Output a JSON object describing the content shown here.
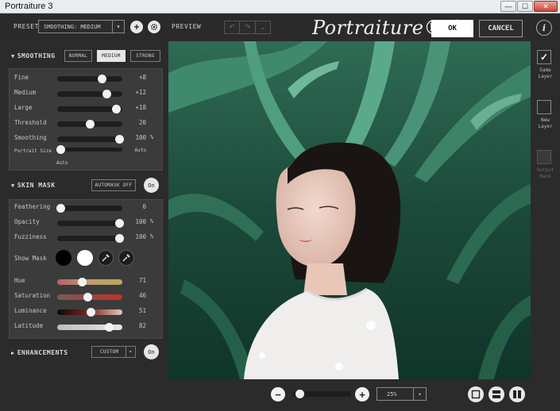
{
  "window": {
    "title": "Portraiture 3",
    "min_glyph": "—",
    "max_glyph": "☐",
    "close_glyph": "✕"
  },
  "toolbar": {
    "preset_label": "PRESET",
    "preset_value": "SMOOTHING: MEDIUM",
    "add_glyph": "+",
    "preview_label": "PREVIEW",
    "logo_text": "Portraiture® 3",
    "ok_label": "OK",
    "cancel_label": "CANCEL",
    "info_label": "i"
  },
  "smoothing": {
    "header": "SMOOTHING",
    "modes": [
      "NORMAL",
      "MEDIUM",
      "STRONG"
    ],
    "active_mode": "MEDIUM",
    "sliders": [
      {
        "label": "Fine",
        "value": "+8",
        "level": 0.68
      },
      {
        "label": "Medium",
        "value": "+12",
        "level": 0.76
      },
      {
        "label": "Large",
        "value": "+18",
        "level": 0.9
      },
      {
        "label": "Threshold",
        "value": "20",
        "level": 0.5
      },
      {
        "label": "Smoothing",
        "value": "100",
        "unit": "%",
        "level": 0.95
      }
    ],
    "portrait_size": {
      "label": "Portrait Size",
      "value": "Auto",
      "sub": "Auto",
      "level": 0.05
    }
  },
  "skin_mask": {
    "header": "SKIN MASK",
    "automask_label": "AUTOMASK OFF",
    "on_label": "On",
    "sliders": [
      {
        "label": "Feathering",
        "value": "0",
        "level": 0.05
      },
      {
        "label": "Opacity",
        "value": "100",
        "unit": "%",
        "level": 0.95
      },
      {
        "label": "Fuzziness",
        "value": "100",
        "unit": "%",
        "level": 0.95
      }
    ],
    "show_mask_label": "Show Mask",
    "color_sliders": [
      {
        "label": "Hue",
        "value": "71",
        "level": 0.38
      },
      {
        "label": "Saturation",
        "value": "46",
        "level": 0.46
      },
      {
        "label": "Luminance",
        "value": "51",
        "level": 0.51
      },
      {
        "label": "Latitude",
        "value": "82",
        "level": 0.79
      }
    ]
  },
  "enhancements": {
    "header": "ENHANCEMENTS",
    "custom_label": "CUSTOM",
    "on_label": "On"
  },
  "output": {
    "items": [
      {
        "label_1": "Same",
        "label_2": "Layer",
        "checked": true,
        "enabled": true
      },
      {
        "label_1": "New",
        "label_2": "Layer",
        "checked": false,
        "enabled": true
      },
      {
        "label_1": "Output",
        "label_2": "Mask",
        "checked": false,
        "enabled": false
      }
    ]
  },
  "zoom": {
    "value": "25%",
    "level": 0.12,
    "minus": "−",
    "plus": "+"
  },
  "colors": {
    "panel": "#2b2b2b",
    "box": "#3b3b3b",
    "accent_white": "#f2f2f2"
  }
}
